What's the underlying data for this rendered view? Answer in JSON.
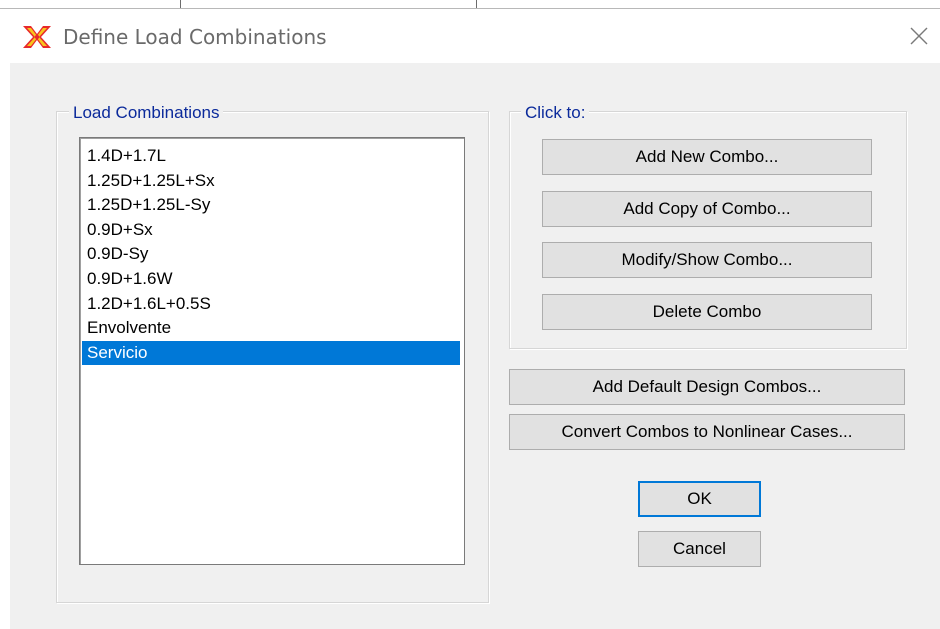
{
  "window": {
    "title": "Define Load Combinations",
    "icon": "sap2000-app-icon",
    "close_icon": "close-icon"
  },
  "colors": {
    "accent": "#0078d7",
    "legend_text": "#0b2a9b",
    "client_bg": "#f0f0f0",
    "button_bg": "#e1e1e1"
  },
  "load_combinations": {
    "legend": "Load Combinations",
    "items": [
      {
        "label": "1.4D+1.7L"
      },
      {
        "label": "1.25D+1.25L+Sx"
      },
      {
        "label": "1.25D+1.25L-Sy"
      },
      {
        "label": "0.9D+Sx"
      },
      {
        "label": "0.9D-Sy"
      },
      {
        "label": "0.9D+1.6W"
      },
      {
        "label": "1.2D+1.6L+0.5S"
      },
      {
        "label": "Envolvente"
      },
      {
        "label": "Servicio"
      }
    ],
    "selected": "Servicio"
  },
  "click_to": {
    "legend": "Click to:",
    "add_new": "Add New Combo...",
    "add_copy": "Add Copy of Combo...",
    "modify_show": "Modify/Show Combo...",
    "delete": "Delete Combo"
  },
  "actions": {
    "add_default": "Add Default Design Combos...",
    "convert": "Convert Combos to Nonlinear Cases...",
    "ok": "OK",
    "cancel": "Cancel"
  }
}
